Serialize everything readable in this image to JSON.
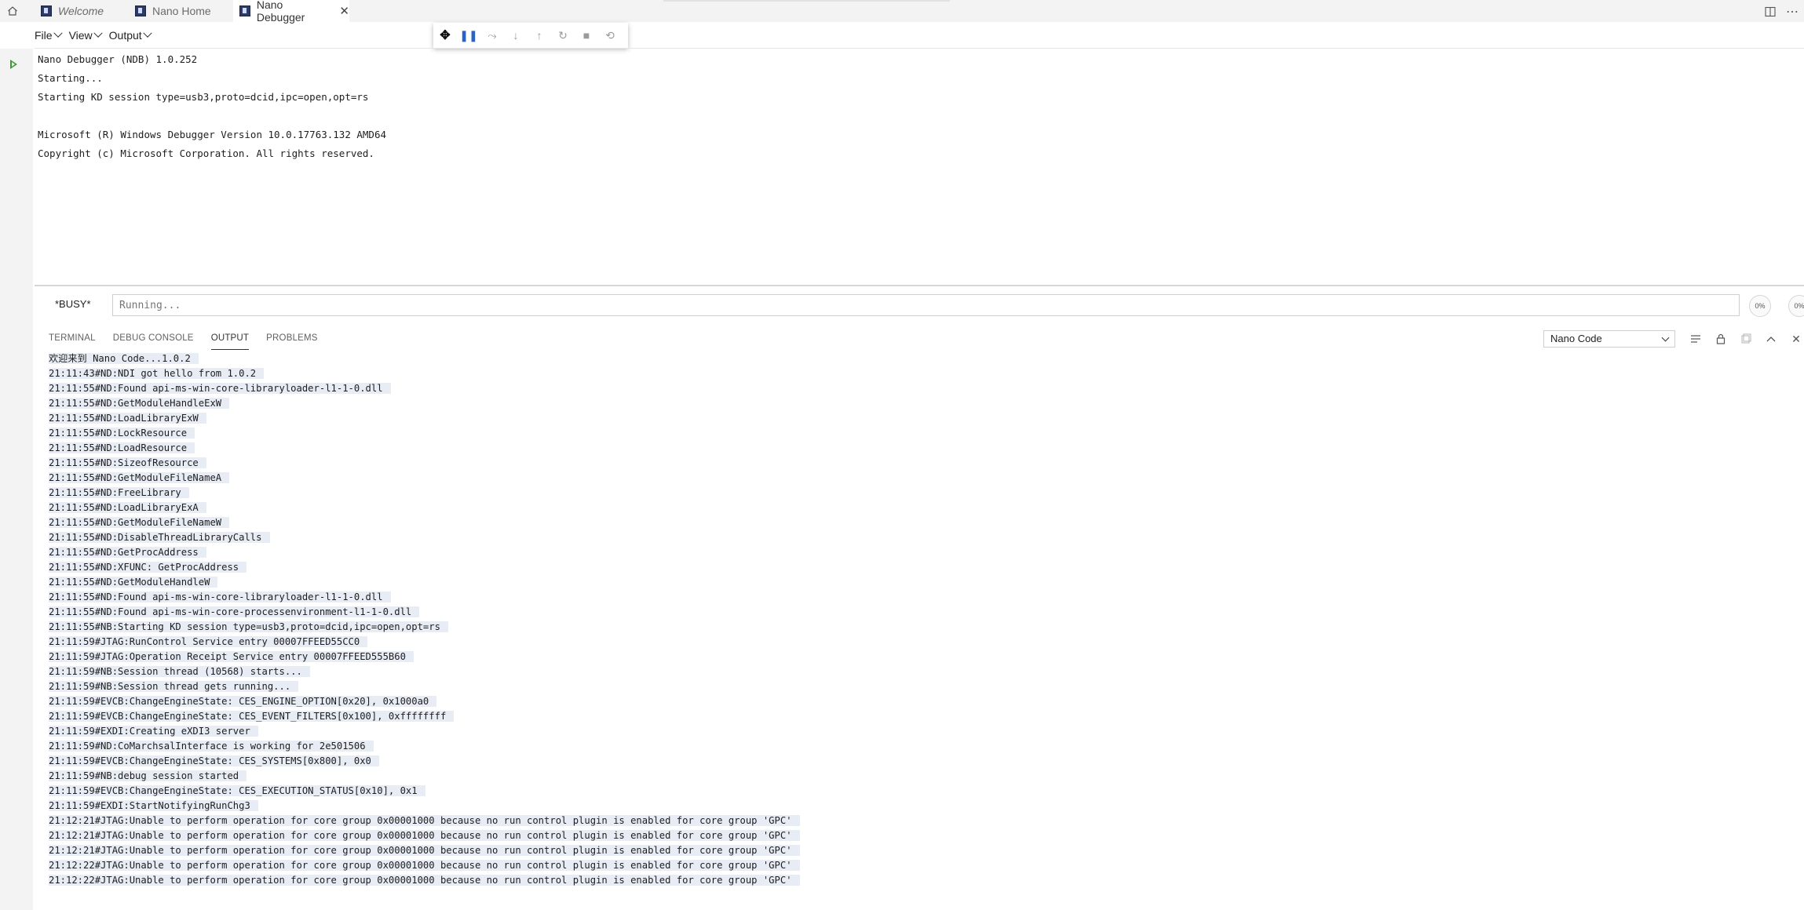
{
  "tabs": [
    {
      "label": "Welcome",
      "italic": true
    },
    {
      "label": "Nano Home",
      "italic": false
    },
    {
      "label": "Nano Debugger",
      "italic": false,
      "active": true,
      "close": "✕"
    }
  ],
  "menu": [
    {
      "label": "File"
    },
    {
      "label": "View"
    },
    {
      "label": "Output"
    }
  ],
  "debug_toolbar": {
    "grip": "✥",
    "pause": "❚❚",
    "step_over": "⤳",
    "step_into": "↓",
    "step_out": "↑",
    "restart": "↻",
    "stop": "■",
    "disconnect": "⟲"
  },
  "console": {
    "lines": [
      "Nano Debugger (NDB) 1.0.252",
      "Starting...",
      "Starting KD session type=usb3,proto=dcid,ipc=open,opt=rs",
      "",
      "Microsoft (R) Windows Debugger Version 10.0.17763.132 AMD64",
      "Copyright (c) Microsoft Corporation. All rights reserved."
    ]
  },
  "command": {
    "status": "*BUSY*",
    "placeholder": "Running...",
    "btn1": "0%",
    "btn2": "0%"
  },
  "panel": {
    "tabs": [
      {
        "label": "TERMINAL"
      },
      {
        "label": "DEBUG CONSOLE"
      },
      {
        "label": "OUTPUT",
        "active": true
      },
      {
        "label": "PROBLEMS"
      }
    ],
    "channel": "Nano Code"
  },
  "output_lines": [
    "欢迎来到 Nano Code...1.0.2",
    "21:11:43#ND:NDI got hello from 1.0.2",
    "21:11:55#ND:Found api-ms-win-core-libraryloader-l1-1-0.dll",
    "21:11:55#ND:GetModuleHandleExW",
    "21:11:55#ND:LoadLibraryExW",
    "21:11:55#ND:LockResource",
    "21:11:55#ND:LoadResource",
    "21:11:55#ND:SizeofResource",
    "21:11:55#ND:GetModuleFileNameA",
    "21:11:55#ND:FreeLibrary",
    "21:11:55#ND:LoadLibraryExA",
    "21:11:55#ND:GetModuleFileNameW",
    "21:11:55#ND:DisableThreadLibraryCalls",
    "21:11:55#ND:GetProcAddress",
    "21:11:55#ND:XFUNC: GetProcAddress",
    "21:11:55#ND:GetModuleHandleW",
    "21:11:55#ND:Found api-ms-win-core-libraryloader-l1-1-0.dll",
    "21:11:55#ND:Found api-ms-win-core-processenvironment-l1-1-0.dll",
    "21:11:55#NB:Starting KD session type=usb3,proto=dcid,ipc=open,opt=rs",
    "21:11:59#JTAG:RunControl Service entry 00007FFEED55CC0",
    "21:11:59#JTAG:Operation Receipt Service entry 00007FFEED555B60",
    "21:11:59#NB:Session thread (10568) starts...",
    "21:11:59#NB:Session thread gets running...",
    "21:11:59#EVCB:ChangeEngineState: CES_ENGINE_OPTION[0x20], 0x1000a0",
    "21:11:59#EVCB:ChangeEngineState: CES_EVENT_FILTERS[0x100], 0xffffffff",
    "21:11:59#EXDI:Creating eXDI3 server",
    "21:11:59#ND:CoMarchsalInterface is working for 2e501506",
    "21:11:59#EVCB:ChangeEngineState: CES_SYSTEMS[0x800], 0x0",
    "21:11:59#NB:debug session started",
    "21:11:59#EVCB:ChangeEngineState: CES_EXECUTION_STATUS[0x10], 0x1",
    "21:11:59#EXDI:StartNotifyingRunChg3",
    "21:12:21#JTAG:Unable to perform operation for core group 0x00001000 because no run control plugin is enabled for core group 'GPC'",
    "21:12:21#JTAG:Unable to perform operation for core group 0x00001000 because no run control plugin is enabled for core group 'GPC'",
    "21:12:21#JTAG:Unable to perform operation for core group 0x00001000 because no run control plugin is enabled for core group 'GPC'",
    "21:12:22#JTAG:Unable to perform operation for core group 0x00001000 because no run control plugin is enabled for core group 'GPC'",
    "21:12:22#JTAG:Unable to perform operation for core group 0x00001000 because no run control plugin is enabled for core group 'GPC'"
  ]
}
